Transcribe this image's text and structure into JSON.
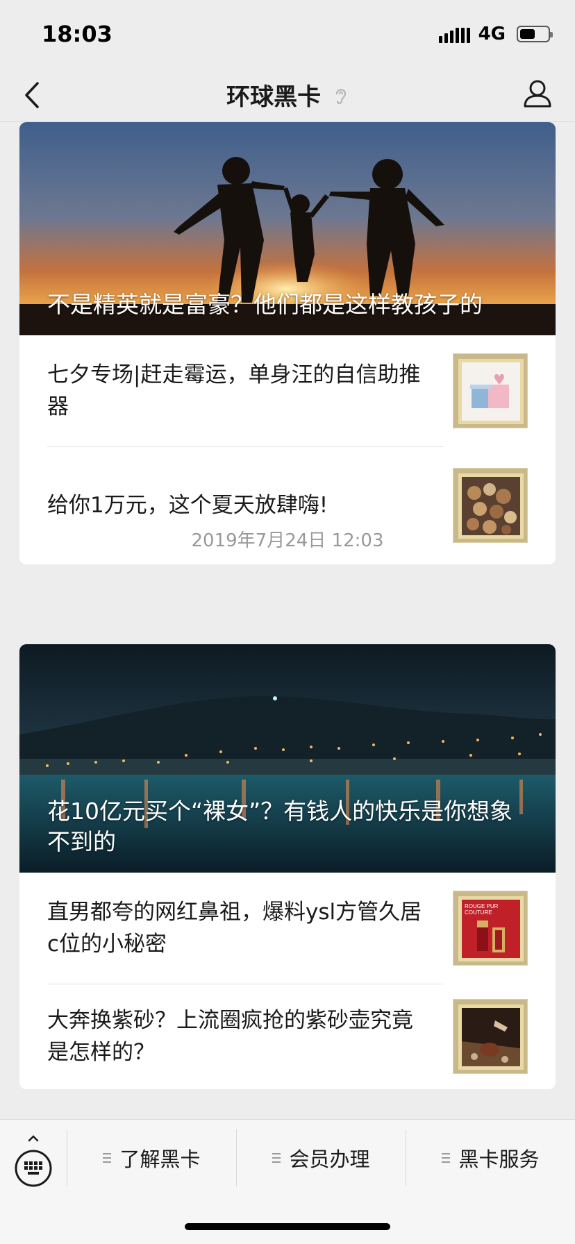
{
  "status": {
    "time": "18:03",
    "network": "4G",
    "battery_level": 0.55
  },
  "nav": {
    "title": "环球黑卡",
    "back_icon": "chevron-left-icon",
    "ear_icon": "ear-icon",
    "profile_icon": "person-icon"
  },
  "cards": [
    {
      "hero_title": "不是精英就是富豪？他们都是这样教孩子的",
      "items": [
        {
          "title": "七夕专场|赶走霉运，单身汪的自信助推器"
        },
        {
          "title": "给你1万元，这个夏天放肆嗨!"
        }
      ]
    },
    {
      "hero_title": "花10亿元买个“裸女”？有钱人的快乐是你想象不到的",
      "items": [
        {
          "title": "直男都夸的网红鼻祖，爆料ysl方管久居c位的小秘密",
          "thumb_text": [
            "ROUGE PUR",
            "COUTURE"
          ]
        },
        {
          "title": "大奔换紫砂？上流圈疯抢的紫砂壶究竟是怎样的？"
        }
      ]
    }
  ],
  "timestamp": "2019年7月24日 12:03",
  "menu": {
    "keyboard_icon": "keyboard-icon",
    "tabs": [
      {
        "label": "了解黑卡"
      },
      {
        "label": "会员办理"
      },
      {
        "label": "黑卡服务"
      }
    ]
  },
  "colors": {
    "background": "#ededed",
    "card": "#ffffff",
    "timestamp": "#999999"
  }
}
